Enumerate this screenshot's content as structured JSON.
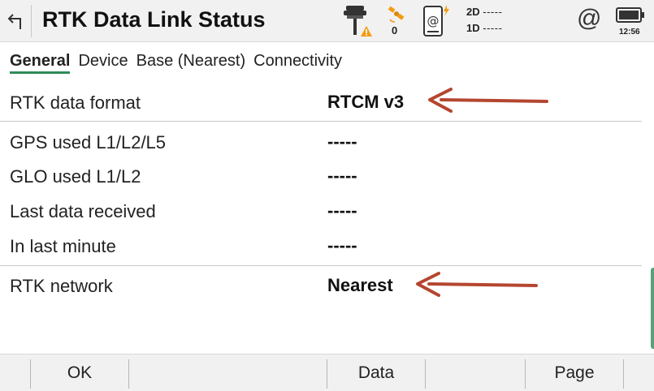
{
  "header": {
    "title": "RTK Data Link Status",
    "satellites_used": "0",
    "precision_2d_label": "2D",
    "precision_2d_value": "-----",
    "precision_1d_label": "1D",
    "precision_1d_value": "-----",
    "at_symbol": "@",
    "time": "12:56",
    "icons": {
      "back": "back-arrow-icon",
      "receiver": "gnss-receiver-warning-icon",
      "satellite": "satellite-icon",
      "controller": "controller-internet-icon",
      "internet": "internet-at-icon",
      "battery": "battery-icon"
    }
  },
  "tabs": [
    {
      "label": "General",
      "active": true
    },
    {
      "label": "Device",
      "active": false
    },
    {
      "label": "Base (Nearest)",
      "active": false
    },
    {
      "label": "Connectivity",
      "active": false
    }
  ],
  "fields": {
    "rtk_format": {
      "label": "RTK data format",
      "value": "RTCM v3"
    },
    "gps_used": {
      "label": "GPS used L1/L2/L5",
      "value": "-----"
    },
    "glo_used": {
      "label": "GLO used L1/L2",
      "value": "-----"
    },
    "last_data": {
      "label": "Last data received",
      "value": "-----"
    },
    "last_minute": {
      "label": "In last minute",
      "value": "-----"
    },
    "rtk_network": {
      "label": "RTK network",
      "value": "Nearest"
    }
  },
  "toolbar": {
    "ok_label": "OK",
    "data_label": "Data",
    "page_label": "Page"
  },
  "colors": {
    "accent": "#2e8b57",
    "annotation_arrow": "#b5462f",
    "warning": "#f39c12",
    "header_bg": "#f1f1f1"
  }
}
